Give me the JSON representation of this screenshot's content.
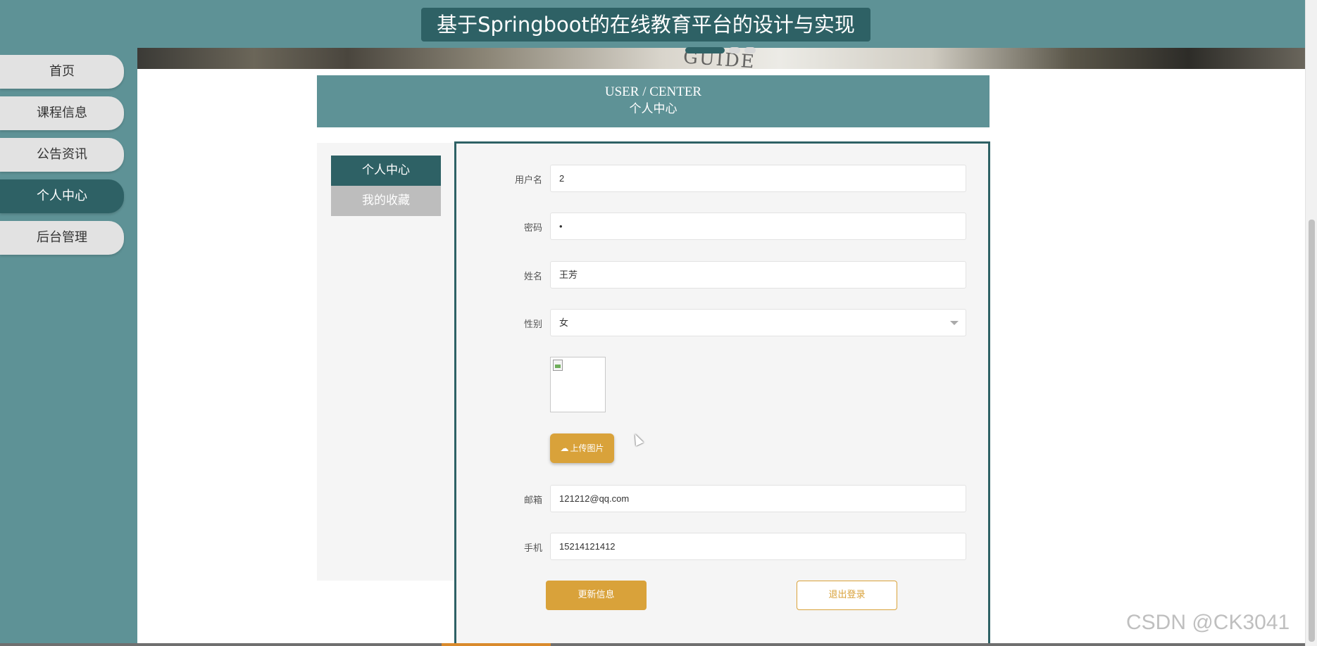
{
  "header": {
    "title": "基于Springboot的在线教育平台的设计与实现"
  },
  "banner": {
    "text": "GUIDE"
  },
  "sidebar": {
    "items": [
      {
        "label": "首页"
      },
      {
        "label": "课程信息"
      },
      {
        "label": "公告资讯"
      },
      {
        "label": "个人中心",
        "active": true
      },
      {
        "label": "后台管理"
      }
    ]
  },
  "user_center": {
    "title_en": "USER / CENTER",
    "title_cn": "个人中心"
  },
  "inner_menu": {
    "items": [
      {
        "label": "个人中心",
        "active": true
      },
      {
        "label": "我的收藏"
      }
    ]
  },
  "form": {
    "username": {
      "label": "用户名",
      "value": "2"
    },
    "password": {
      "label": "密码",
      "value": "•"
    },
    "name": {
      "label": "姓名",
      "value": "王芳"
    },
    "gender": {
      "label": "性别",
      "value": "女"
    },
    "upload_label": "上传图片",
    "email": {
      "label": "邮箱",
      "value": "121212@qq.com"
    },
    "phone": {
      "label": "手机",
      "value": "15214121412"
    },
    "update_label": "更新信息",
    "logout_label": "退出登录"
  },
  "watermark": "CSDN @CK3041",
  "colors": {
    "primary": "#2e6165",
    "teal": "#5e9296",
    "accent": "#d9a23a"
  }
}
